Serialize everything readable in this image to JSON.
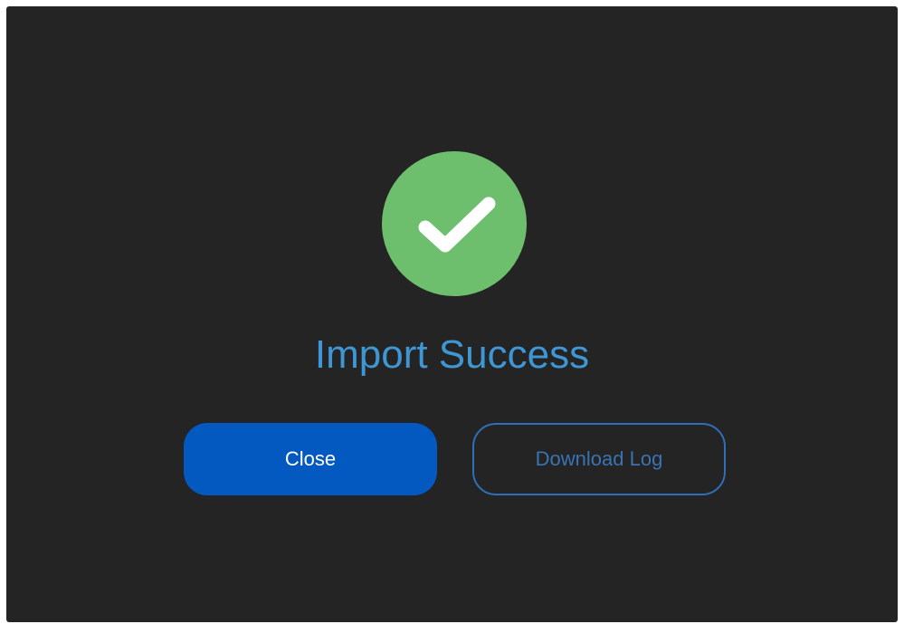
{
  "dialog": {
    "status_icon": "checkmark-circle-icon",
    "title": "Import Success",
    "close_label": "Close",
    "download_log_label": "Download Log"
  },
  "colors": {
    "background": "#242424",
    "success_green": "#6dbf6d",
    "title_blue": "#3f96d4",
    "primary_button": "#0459c0",
    "secondary_border": "#2f6fb8"
  }
}
